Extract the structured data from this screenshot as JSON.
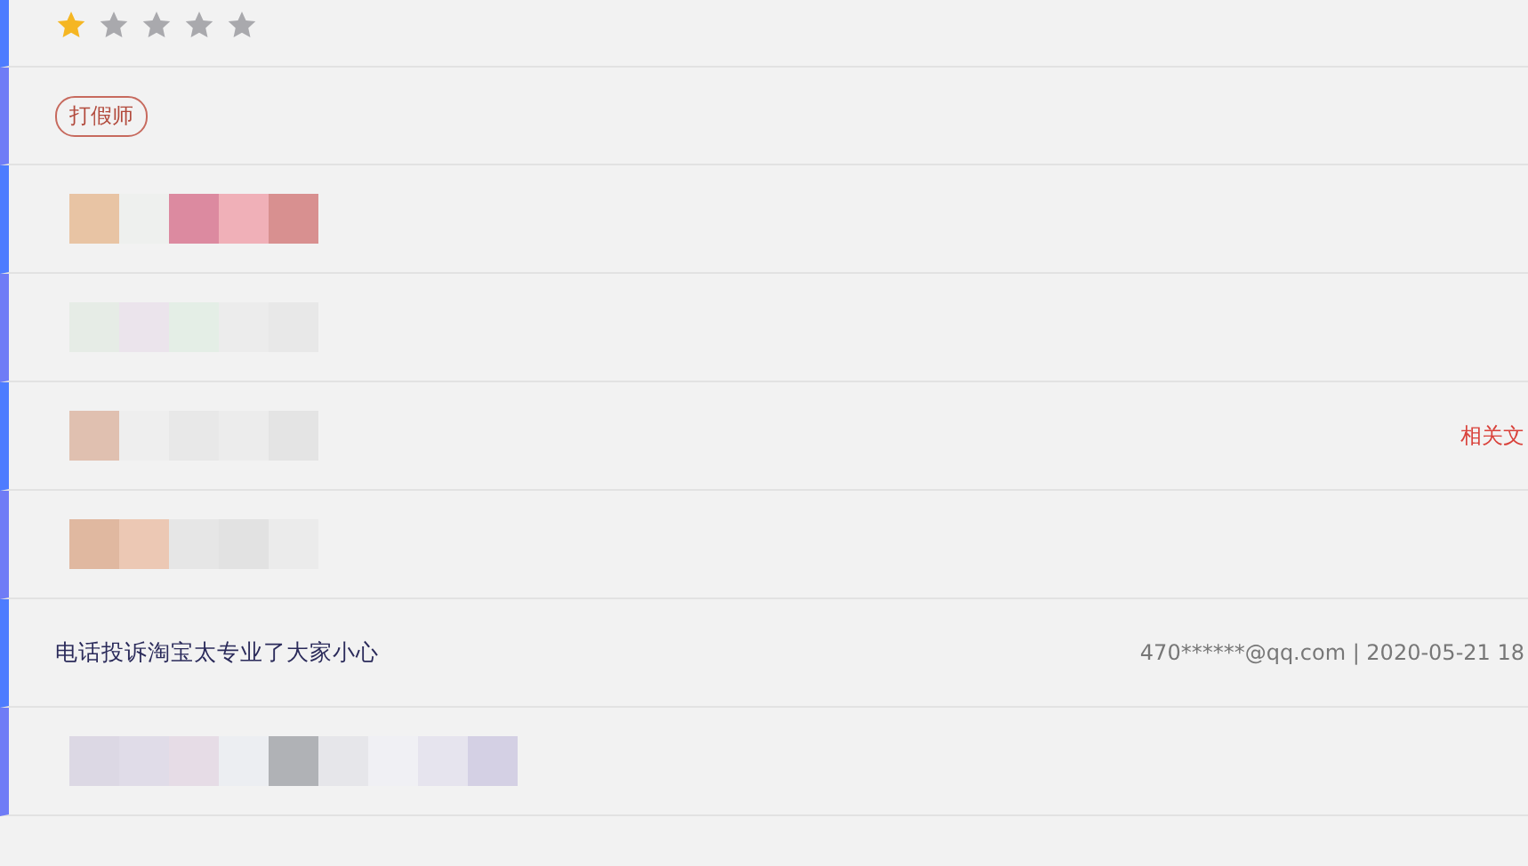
{
  "rows": [
    {
      "kind": "stars",
      "stars": 1
    },
    {
      "kind": "tag",
      "tag": "打假师"
    },
    {
      "kind": "redacted"
    },
    {
      "kind": "redacted"
    },
    {
      "kind": "redacted",
      "link": "相关文"
    },
    {
      "kind": "redacted"
    },
    {
      "kind": "text",
      "text": "电话投诉淘宝太专业了大家小心",
      "meta": "470******@qq.com | 2020-05-21 18"
    },
    {
      "kind": "redacted"
    }
  ]
}
